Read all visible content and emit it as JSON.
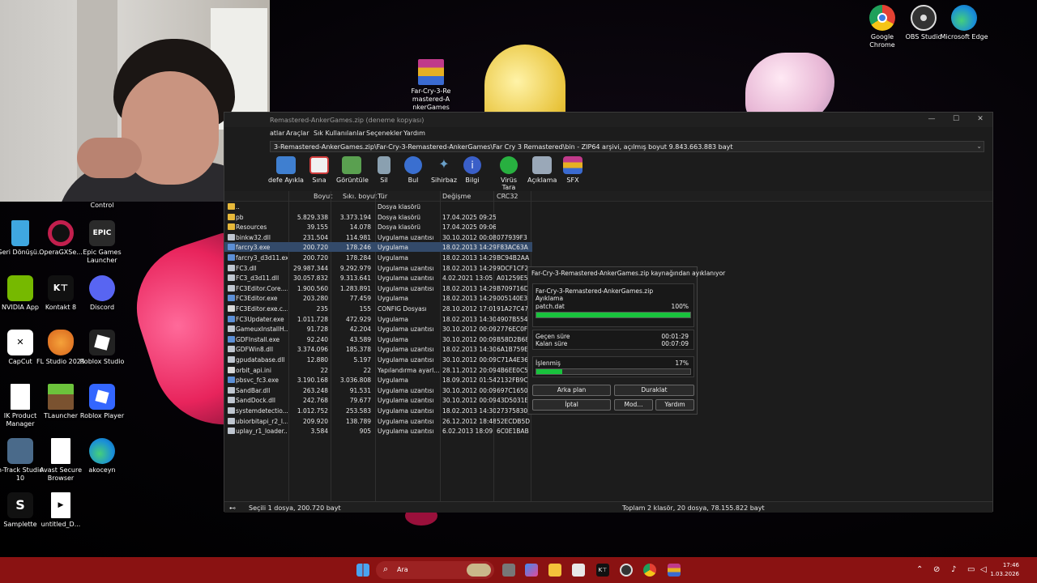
{
  "desktop": {
    "top_icons": [
      {
        "label": "Google Chrome",
        "icon": "chrome-icon",
        "color": "#e34133"
      },
      {
        "label": "OBS Studio",
        "icon": "obs-icon",
        "color": "#333333"
      },
      {
        "label": "Microsoft Edge",
        "icon": "edge-icon",
        "color": "#1a8fd8"
      }
    ],
    "archive_icon": {
      "label": "Far-Cry-3-Remastered-AnkerGames",
      "icon": "winrar-archive-icon"
    },
    "left_icons": [
      {
        "label": "Control",
        "icon": "control-panel-icon"
      },
      {
        "label": "Geri Dönüşü...",
        "icon": "recycle-bin-icon",
        "color": "#3fa7e0"
      },
      {
        "label": "OperaGXSe...",
        "icon": "opera-gx-icon",
        "color": "#c21f4d"
      },
      {
        "label": "Epic Games Launcher",
        "icon": "epic-games-icon",
        "color": "#2a2a2a"
      },
      {
        "label": "NVIDIA App",
        "icon": "nvidia-icon",
        "color": "#76b900"
      },
      {
        "label": "Kontakt 8",
        "icon": "kontakt-icon",
        "color": "#111111"
      },
      {
        "label": "Discord",
        "icon": "discord-icon",
        "color": "#5865f2"
      },
      {
        "label": "CapCut",
        "icon": "capcut-icon",
        "color": "#ffffff"
      },
      {
        "label": "FL Studio 2025",
        "icon": "fl-studio-icon",
        "color": "#f28c28"
      },
      {
        "label": "Roblox Studio",
        "icon": "roblox-studio-icon",
        "color": "#222222"
      },
      {
        "label": "IK Product Manager",
        "icon": "file-icon",
        "color": "#ffffff"
      },
      {
        "label": "TLauncher",
        "icon": "tlauncher-icon",
        "color": "#5aa832"
      },
      {
        "label": "Roblox Player",
        "icon": "roblox-player-icon",
        "color": "#3366ff"
      },
      {
        "label": "n-Track Studio 10",
        "icon": "n-track-icon",
        "color": "#4a6a8a"
      },
      {
        "label": "Avast Secure Browser",
        "icon": "file-icon",
        "color": "#ffffff"
      },
      {
        "label": "akoceyn",
        "icon": "edge-icon",
        "color": "#1a8fd8"
      },
      {
        "label": "Samplette",
        "icon": "samplette-icon",
        "color": "#111111"
      },
      {
        "label": "untitled_D...",
        "icon": "video-file-icon",
        "color": "#ffffff"
      }
    ]
  },
  "winrar": {
    "title": "Remastered-AnkerGames.zip (deneme kopyası)",
    "menu": [
      "atlar",
      "Araçlar",
      "Sık Kullanılanlar",
      "Seçenekler",
      "Yardım"
    ],
    "address": "3-Remastered-AnkerGames.zip\\Far-Cry-3-Remastered-AnkerGames\\Far Cry 3 Remastered\\bin - ZIP64 arşivi, açılmış boyut 9.843.663.883 bayt",
    "toolbar": [
      {
        "label": "defe Ayıkla",
        "icon": "extract-to-icon",
        "color": "#3f7fd0"
      },
      {
        "label": "Sına",
        "icon": "test-icon",
        "color": "#d03c3c"
      },
      {
        "label": "Görüntüle",
        "icon": "view-icon",
        "color": "#5aa050"
      },
      {
        "label": "Sil",
        "icon": "delete-icon",
        "color": "#8aa0b0"
      },
      {
        "label": "Bul",
        "icon": "find-icon",
        "color": "#3a6fd0"
      },
      {
        "label": "Sihirbaz",
        "icon": "wizard-icon",
        "color": "#6aa0c8"
      },
      {
        "label": "Bilgi",
        "icon": "info-icon",
        "color": "#3a5fc8"
      },
      {
        "label": "Virüs Tara",
        "icon": "virus-scan-icon",
        "color": "#28b040"
      },
      {
        "label": "Açıklama",
        "icon": "comment-icon",
        "color": "#9aa8b8"
      },
      {
        "label": "SFX",
        "icon": "sfx-icon",
        "color": "#d84848"
      }
    ],
    "columns": [
      "Boyut",
      "Sıkı. boyut",
      "Tür",
      "Değişme",
      "CRC32"
    ],
    "files": [
      {
        "name": "..",
        "size": "",
        "packed": "",
        "type": "Dosya klasörü",
        "modified": "",
        "crc": "",
        "kind": "folder"
      },
      {
        "name": "pb",
        "size": "5.829.338",
        "packed": "3.373.194",
        "type": "Dosya klasörü",
        "modified": "17.04.2025 09:25",
        "crc": "",
        "kind": "folder"
      },
      {
        "name": "Resources",
        "size": "39.155",
        "packed": "14.078",
        "type": "Dosya klasörü",
        "modified": "17.04.2025 09:06",
        "crc": "",
        "kind": "folder"
      },
      {
        "name": "binkw32.dll",
        "size": "231.504",
        "packed": "114.981",
        "type": "Uygulama uzantısı",
        "modified": "30.10.2012 00:08",
        "crc": "077939F3",
        "kind": "dll"
      },
      {
        "name": "farcry3.exe",
        "size": "200.720",
        "packed": "178.246",
        "type": "Uygulama",
        "modified": "18.02.2013 14:29",
        "crc": "F83AC63A",
        "kind": "exe",
        "selected": true
      },
      {
        "name": "farcry3_d3d11.exe",
        "size": "200.720",
        "packed": "178.284",
        "type": "Uygulama",
        "modified": "18.02.2013 14:29",
        "crc": "BC94B2AA",
        "kind": "exe"
      },
      {
        "name": "FC3.dll",
        "size": "29.987.344",
        "packed": "9.292.979",
        "type": "Uygulama uzantısı",
        "modified": "18.02.2013 14:29",
        "crc": "9DCF1CF2",
        "kind": "dll"
      },
      {
        "name": "FC3_d3d11.dll",
        "size": "30.057.832",
        "packed": "9.313.641",
        "type": "Uygulama uzantısı",
        "modified": "4.02.2021 13:05",
        "crc": "A01259E5",
        "kind": "dll"
      },
      {
        "name": "FC3Editor.Core....",
        "size": "1.900.560",
        "packed": "1.283.891",
        "type": "Uygulama uzantısı",
        "modified": "18.02.2013 14:29",
        "crc": "B709716D",
        "kind": "dll"
      },
      {
        "name": "FC3Editor.exe",
        "size": "203.280",
        "packed": "77.459",
        "type": "Uygulama",
        "modified": "18.02.2013 14:29",
        "crc": "005140E3",
        "kind": "exe"
      },
      {
        "name": "FC3Editor.exe.c...",
        "size": "235",
        "packed": "155",
        "type": "CONFIG Dosyası",
        "modified": "28.10.2012 17:01",
        "crc": "91A27C47",
        "kind": "file"
      },
      {
        "name": "FC3Updater.exe",
        "size": "1.011.728",
        "packed": "472.929",
        "type": "Uygulama",
        "modified": "18.02.2013 14:30",
        "crc": "4907B554",
        "kind": "exe"
      },
      {
        "name": "GameuxInstallH...",
        "size": "91.728",
        "packed": "42.204",
        "type": "Uygulama uzantısı",
        "modified": "30.10.2012 00:09",
        "crc": "2776EC0F",
        "kind": "dll"
      },
      {
        "name": "GDFInstall.exe",
        "size": "92.240",
        "packed": "43.589",
        "type": "Uygulama",
        "modified": "30.10.2012 00:09",
        "crc": "B58D2B68",
        "kind": "exe"
      },
      {
        "name": "GDFWin8.dll",
        "size": "3.374.096",
        "packed": "185.378",
        "type": "Uygulama uzantısı",
        "modified": "18.02.2013 14:30",
        "crc": "6A1B759E",
        "kind": "dll"
      },
      {
        "name": "gpudatabase.dll",
        "size": "12.880",
        "packed": "5.197",
        "type": "Uygulama uzantısı",
        "modified": "30.10.2012 00:09",
        "crc": "C71A4E36",
        "kind": "dll"
      },
      {
        "name": "orbit_api.ini",
        "size": "22",
        "packed": "22",
        "type": "Yapılandırma ayarl...",
        "modified": "28.11.2012 20:09",
        "crc": "4B6EE0C5",
        "kind": "file"
      },
      {
        "name": "pbsvc_fc3.exe",
        "size": "3.190.168",
        "packed": "3.036.808",
        "type": "Uygulama",
        "modified": "18.09.2012 01:54",
        "crc": "2132FB9C",
        "kind": "exe"
      },
      {
        "name": "SandBar.dll",
        "size": "263.248",
        "packed": "91.531",
        "type": "Uygulama uzantısı",
        "modified": "30.10.2012 00:09",
        "crc": "697C1650",
        "kind": "dll"
      },
      {
        "name": "SandDock.dll",
        "size": "242.768",
        "packed": "79.677",
        "type": "Uygulama uzantısı",
        "modified": "30.10.2012 00:09",
        "crc": "43D5031E",
        "kind": "dll"
      },
      {
        "name": "systemdetectio...",
        "size": "1.012.752",
        "packed": "253.583",
        "type": "Uygulama uzantısı",
        "modified": "18.02.2013 14:30",
        "crc": "27375830",
        "kind": "dll"
      },
      {
        "name": "ubiorbitapi_r2_l...",
        "size": "209.920",
        "packed": "138.789",
        "type": "Uygulama uzantısı",
        "modified": "26.12.2012 18:48",
        "crc": "52ECDB5D",
        "kind": "dll"
      },
      {
        "name": "uplay_r1_loader....",
        "size": "3.584",
        "packed": "905",
        "type": "Uygulama uzantısı",
        "modified": "6.02.2013 18:09",
        "crc": "6C0E1BAB",
        "kind": "dll"
      }
    ],
    "status_left": "Seçili 1 dosya, 200.720 bayt",
    "status_right": "Toplam 2 klasör, 20 dosya, 78.155.822 bayt"
  },
  "extract_dialog": {
    "title": "Far-Cry-3-Remastered-AnkerGames.zip kaynağından ayıklanıyor",
    "archive": "Far-Cry-3-Remastered-AnkerGames.zip",
    "action": "Ayıklama",
    "current_file": "patch.dat",
    "file_percent": "100%",
    "file_progress": 1.0,
    "elapsed_label": "Geçen süre",
    "elapsed": "00:01:29",
    "remaining_label": "Kalan süre",
    "remaining": "00:07:09",
    "processed_label": "İşlenmiş",
    "processed_percent": "17%",
    "processed_progress": 0.17,
    "buttons": {
      "background": "Arka plan",
      "pause": "Duraklat",
      "cancel": "İptal",
      "mode": "Mod...",
      "help": "Yardım"
    }
  },
  "taskbar": {
    "search_placeholder": "Ara",
    "time": "17:46",
    "date": "1.03.2026",
    "color": "#8a1212"
  }
}
